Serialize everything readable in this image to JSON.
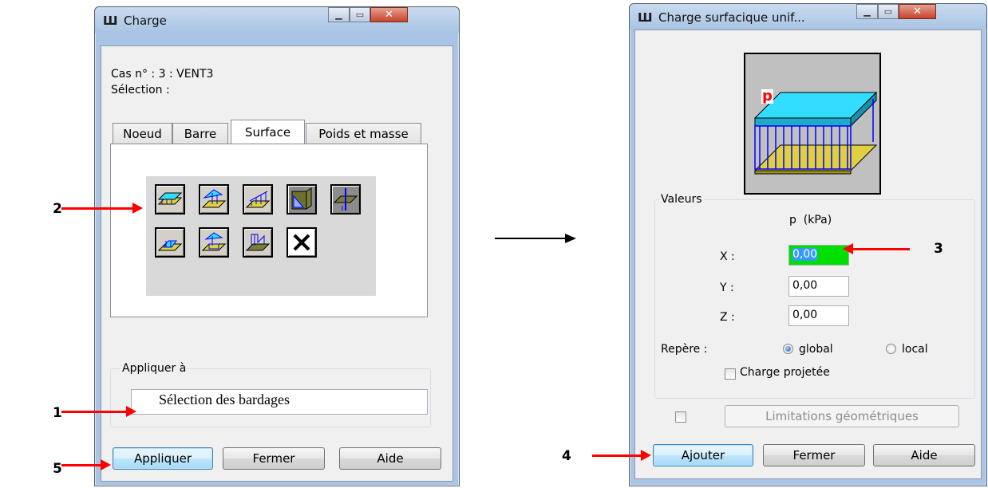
{
  "annotations": {
    "n1": "1",
    "n2": "2",
    "n3": "3",
    "n4": "4",
    "n5": "5"
  },
  "left_dialog": {
    "title": "Charge",
    "case_line": "Cas n° : 3 : VENT3",
    "selection_line": "Sélection :",
    "tabs": [
      "Noeud",
      "Barre",
      "Surface",
      "Poids et masse"
    ],
    "tools_row1": [
      "uniform-surface-load-icon",
      "point-load-on-surface-icon",
      "linear-surface-load-icon",
      "hydrostatic-load-icon",
      "thermal-load-icon"
    ],
    "tools_row2": [
      "contour-load-icon",
      "point-load-contour-icon",
      "linear-load-3points-icon",
      "delete-load-icon"
    ],
    "apply_to_label": "Appliquer à",
    "apply_to_value": "Sélection des bardages",
    "buttons": {
      "apply": "Appliquer",
      "close": "Fermer",
      "help": "Aide"
    }
  },
  "right_dialog": {
    "title": "Charge surfacique unif...",
    "preview_label": "p",
    "values_group": "Valeurs",
    "unit_header": "p  (kPa)",
    "x_label": "X :",
    "y_label": "Y :",
    "z_label": "Z :",
    "x_value": "0,00",
    "y_value": "0,00",
    "z_value": "0,00",
    "frame_label": "Repère :",
    "frame_global": "global",
    "frame_local": "local",
    "projected_load": "Charge projetée",
    "geometric_limits": "Limitations géométriques",
    "buttons": {
      "add": "Ajouter",
      "close": "Fermer",
      "help": "Aide"
    }
  },
  "colors": {
    "highlight_field": "#00e000",
    "arrow": "#ff0000",
    "slab_top": "#33ddff",
    "slab_base": "#e0d040"
  }
}
